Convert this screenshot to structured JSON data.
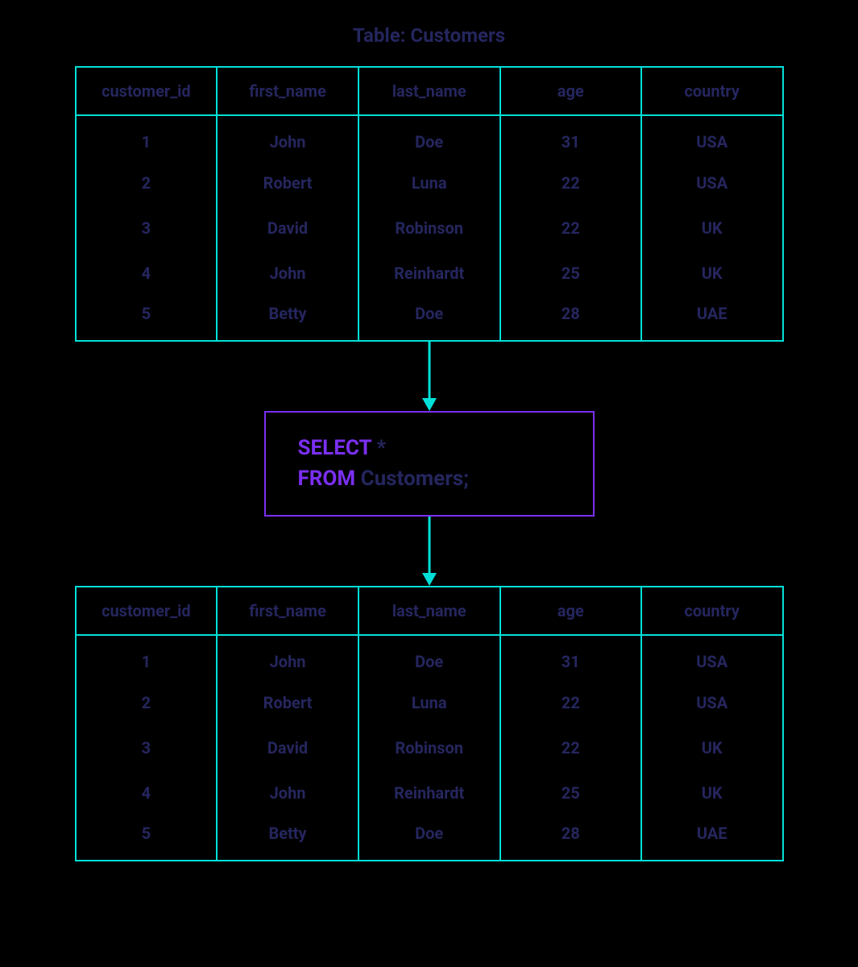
{
  "title": "Table: Customers",
  "columns": [
    "customer_id",
    "first_name",
    "last_name",
    "age",
    "country"
  ],
  "sourceRows": [
    [
      "1",
      "John",
      "Doe",
      "31",
      "USA"
    ],
    [
      "2",
      "Robert",
      "Luna",
      "22",
      "USA"
    ],
    [
      "3",
      "David",
      "Robinson",
      "22",
      "UK"
    ],
    [
      "4",
      "John",
      "Reinhardt",
      "25",
      "UK"
    ],
    [
      "5",
      "Betty",
      "Doe",
      "28",
      "UAE"
    ]
  ],
  "sql": {
    "kw1": "SELECT",
    "rest1": " *",
    "kw2": "FROM",
    "rest2": " Customers;"
  },
  "resultColumns": [
    "customer_id",
    "first_name",
    "last_name",
    "age",
    "country"
  ],
  "resultRows": [
    [
      "1",
      "John",
      "Doe",
      "31",
      "USA"
    ],
    [
      "2",
      "Robert",
      "Luna",
      "22",
      "USA"
    ],
    [
      "3",
      "David",
      "Robinson",
      "22",
      "UK"
    ],
    [
      "4",
      "John",
      "Reinhardt",
      "25",
      "UK"
    ],
    [
      "5",
      "Betty",
      "Doe",
      "28",
      "UAE"
    ]
  ],
  "colors": {
    "border": "#00e0d8",
    "accent": "#7b2ff2",
    "text": "#25265e"
  }
}
